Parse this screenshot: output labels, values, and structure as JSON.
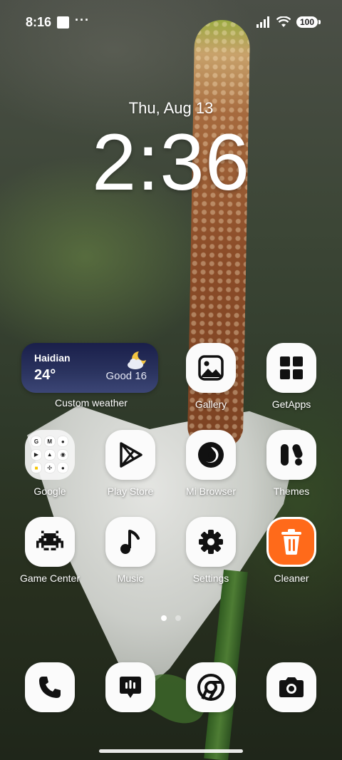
{
  "status_bar": {
    "time": "8:16",
    "more": "···",
    "battery": "100"
  },
  "lock_clock": {
    "date": "Thu, Aug 13",
    "time": "2:36"
  },
  "weather_widget": {
    "city": "Haidian",
    "temperature": "24°",
    "air_quality": "Good 16",
    "icon": "partly-cloudy-night-icon",
    "label": "Custom weather"
  },
  "apps": [
    {
      "label": "Gallery",
      "icon": "gallery-icon"
    },
    {
      "label": "GetApps",
      "icon": "getapps-icon"
    },
    {
      "label": "Google",
      "icon": "google-folder"
    },
    {
      "label": "Play Store",
      "icon": "play-store-icon"
    },
    {
      "label": "Mi Browser",
      "icon": "mi-browser-icon"
    },
    {
      "label": "Themes",
      "icon": "themes-icon"
    },
    {
      "label": "Game Center",
      "icon": "game-center-icon"
    },
    {
      "label": "Music",
      "icon": "music-icon"
    },
    {
      "label": "Settings",
      "icon": "settings-icon"
    },
    {
      "label": "Cleaner",
      "icon": "cleaner-icon"
    }
  ],
  "google_folder_icons": [
    "G",
    "M",
    "mic",
    "yt",
    "drive",
    "play",
    "meet",
    "photos",
    "contacts"
  ],
  "dock": [
    {
      "icon": "phone-icon"
    },
    {
      "icon": "messages-icon"
    },
    {
      "icon": "chrome-icon"
    },
    {
      "icon": "camera-icon"
    }
  ],
  "pages": {
    "count": 2,
    "active": 1
  },
  "colors": {
    "icon_bg": "#fbfbfb",
    "icon_glyph": "#111111",
    "cleaner": "#ff6a1a",
    "weather_bg": "#1a1f4a"
  }
}
